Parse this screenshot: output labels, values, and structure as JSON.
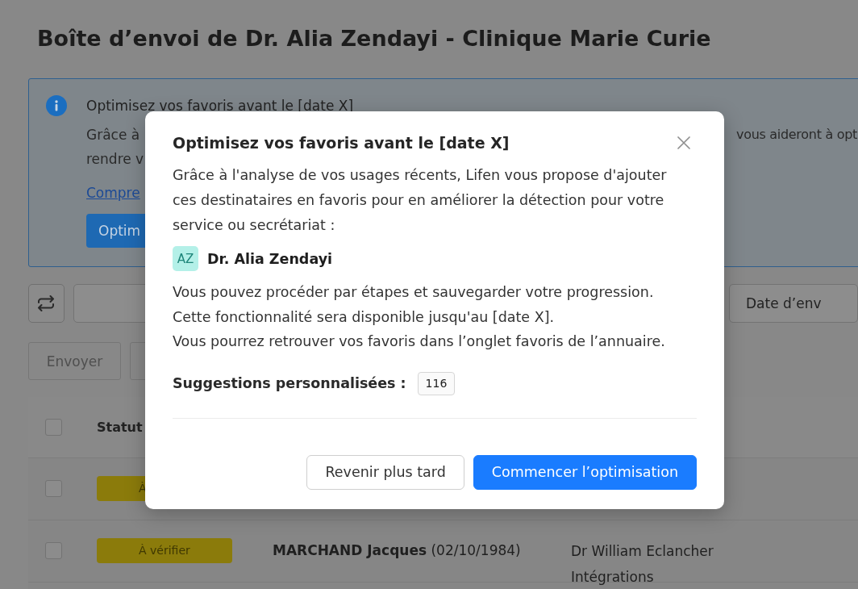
{
  "page_title": "Boîte d’envoi de Dr. Alia Zendayi - Clinique Marie Curie",
  "banner": {
    "title": "Optimisez vos favoris avant le [date X]",
    "lines": [
      {
        "left": "Grâce à",
        "right": "vous aideront à opt"
      },
      {
        "left": "rendre v"
      }
    ],
    "link": "Compre",
    "button": "Optim"
  },
  "toolbar": {
    "date_filter": "Date d’env"
  },
  "actions": [
    {
      "label": "Envoyer",
      "disabled": true
    },
    {
      "disabled": true
    }
  ],
  "table": {
    "header_checked": false,
    "columns": [
      "Statut"
    ],
    "rows": [
      {
        "checked": false,
        "column_1": "À"
      },
      {
        "checked": false,
        "column_1": "À vérifier",
        "column_2": "**MARCHAND Jacques** (02/10/1984)",
        "column_3": [
          "Dr William Eclancher",
          "Intégrations"
        ]
      }
    ]
  },
  "modal": {
    "title": "Optimisez vos favoris avant le [date X]",
    "intro": "Grâce à l'analyse de vos usages récents, Lifen vous propose d'ajouter ces destinataires en favoris pour en améliorer la détection pour votre service ou secrétariat :",
    "recipients": [
      {
        "initials": "AZ",
        "name": "Dr. Alia Zendayi"
      }
    ],
    "notes": [
      "Vous pouvez procéder par étapes et sauvegarder votre progression.",
      "Cette fonctionnalité sera disponible jusqu'au [date X].",
      "Vous pourrez retrouver vos favoris dans l’onglet favoris de l’annuaire."
    ],
    "suggestions": {
      "label": "Suggestions personnalisées :",
      "count": "116"
    },
    "buttons": [
      {
        "label": "Revenir plus tard",
        "kind": "secondary"
      },
      {
        "label": "Commencer l’optimisation",
        "kind": "primary"
      }
    ]
  }
}
